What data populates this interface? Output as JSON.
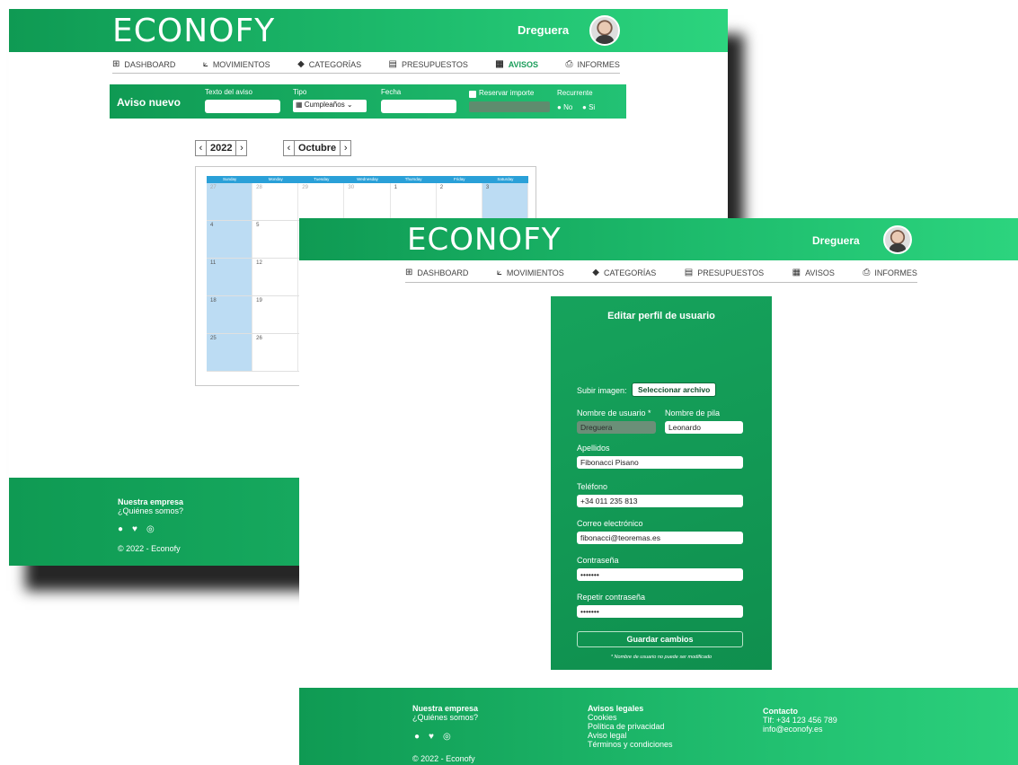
{
  "brand": {
    "logo_text": "ECONOFY"
  },
  "user": {
    "name": "Dreguera"
  },
  "nav": [
    {
      "icon": "⊞",
      "label": "DASHBOARD"
    },
    {
      "icon": "⟀",
      "label": "MOVIMIENTOS"
    },
    {
      "icon": "◆",
      "label": "CATEGORÍAS"
    },
    {
      "icon": "▤",
      "label": "PRESUPUESTOS"
    },
    {
      "icon": "▦",
      "label": "AVISOS"
    },
    {
      "icon": "⎙",
      "label": "INFORMES"
    }
  ],
  "back": {
    "aviso_form": {
      "title": "Aviso nuevo",
      "texto_label": "Texto del aviso",
      "tipo_label": "Tipo",
      "tipo_value": "Cumpleaños",
      "fecha_label": "Fecha",
      "reservar_label": "Reservar importe",
      "recurrente_label": "Recurrente",
      "no_label": "No",
      "si_label": "Si"
    },
    "year": "2022",
    "month": "Octubre",
    "calendar": {
      "days": [
        "Sunday",
        "Monday",
        "Tuesday",
        "Wednesday",
        "Thursday",
        "Friday",
        "Saturday"
      ],
      "rows": [
        [
          "27",
          "28",
          "29",
          "30",
          "1",
          "2",
          "3"
        ],
        [
          "4",
          "5",
          "",
          "",
          "",
          "",
          ""
        ],
        [
          "11",
          "12",
          "",
          "",
          "",
          "",
          ""
        ],
        [
          "18",
          "19",
          "",
          "",
          "",
          "",
          ""
        ],
        [
          "25",
          "26",
          "",
          "",
          "",
          "",
          ""
        ]
      ]
    },
    "footer": {
      "company_title": "Nuestra empresa",
      "company_link": "¿Quiénes somos?",
      "copyright": "© 2022 - Econofy"
    }
  },
  "profile": {
    "title": "Editar perfil de usuario",
    "upload_label": "Subir imagen:",
    "upload_button": "Seleccionar archivo",
    "username_label": "Nombre de usuario *",
    "username_value": "Dreguera",
    "firstname_label": "Nombre de pila",
    "firstname_value": "Leonardo",
    "lastname_label": "Apellidos",
    "lastname_value": "Fibonacci Pisano",
    "phone_label": "Teléfono",
    "phone_value": "+34 011 235 813",
    "email_label": "Correo electrónico",
    "email_value": "fibonacci@teoremas.es",
    "password_label": "Contraseña",
    "password_value": "•••••••",
    "repeat_label": "Repetir contraseña",
    "repeat_value": "•••••••",
    "save_button": "Guardar cambios",
    "note": "* Nombre de usuario no puede ser modificado"
  },
  "footer": {
    "company_title": "Nuestra empresa",
    "company_link": "¿Quiénes somos?",
    "copyright": "© 2022 - Econofy",
    "legal_title": "Avisos legales",
    "legal_links": [
      "Cookies",
      "Política de privacidad",
      "Aviso legal",
      "Términos y condiciones"
    ],
    "contact_title": "Contacto",
    "contact_phone": "Tlf: +34 123 456 789",
    "contact_email": "info@econofy.es"
  },
  "colors": {
    "brand_green": "#16a35c",
    "accent_light_green": "#2cd47e",
    "calendar_blue": "#2aa0d8",
    "weekend_blue": "#bcdcf3"
  }
}
